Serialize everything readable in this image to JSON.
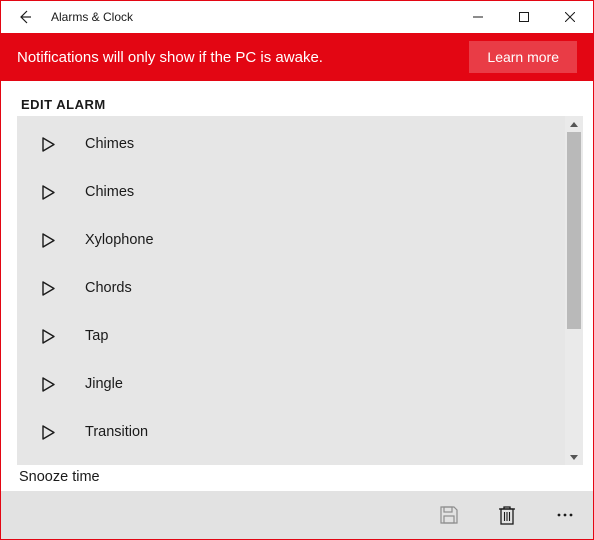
{
  "titlebar": {
    "app_title": "Alarms & Clock"
  },
  "banner": {
    "message": "Notifications will only show if the PC is awake.",
    "learn_more_label": "Learn more"
  },
  "edit_alarm": {
    "heading": "EDIT ALARM",
    "sounds": [
      {
        "label": "Chimes"
      },
      {
        "label": "Chimes"
      },
      {
        "label": "Xylophone"
      },
      {
        "label": "Chords"
      },
      {
        "label": "Tap"
      },
      {
        "label": "Jingle"
      },
      {
        "label": "Transition"
      }
    ],
    "snooze_label": "Snooze time"
  },
  "colors": {
    "accent": "#e30613",
    "panel": "#e6e6e6",
    "bottombar": "#e2e2e2"
  }
}
